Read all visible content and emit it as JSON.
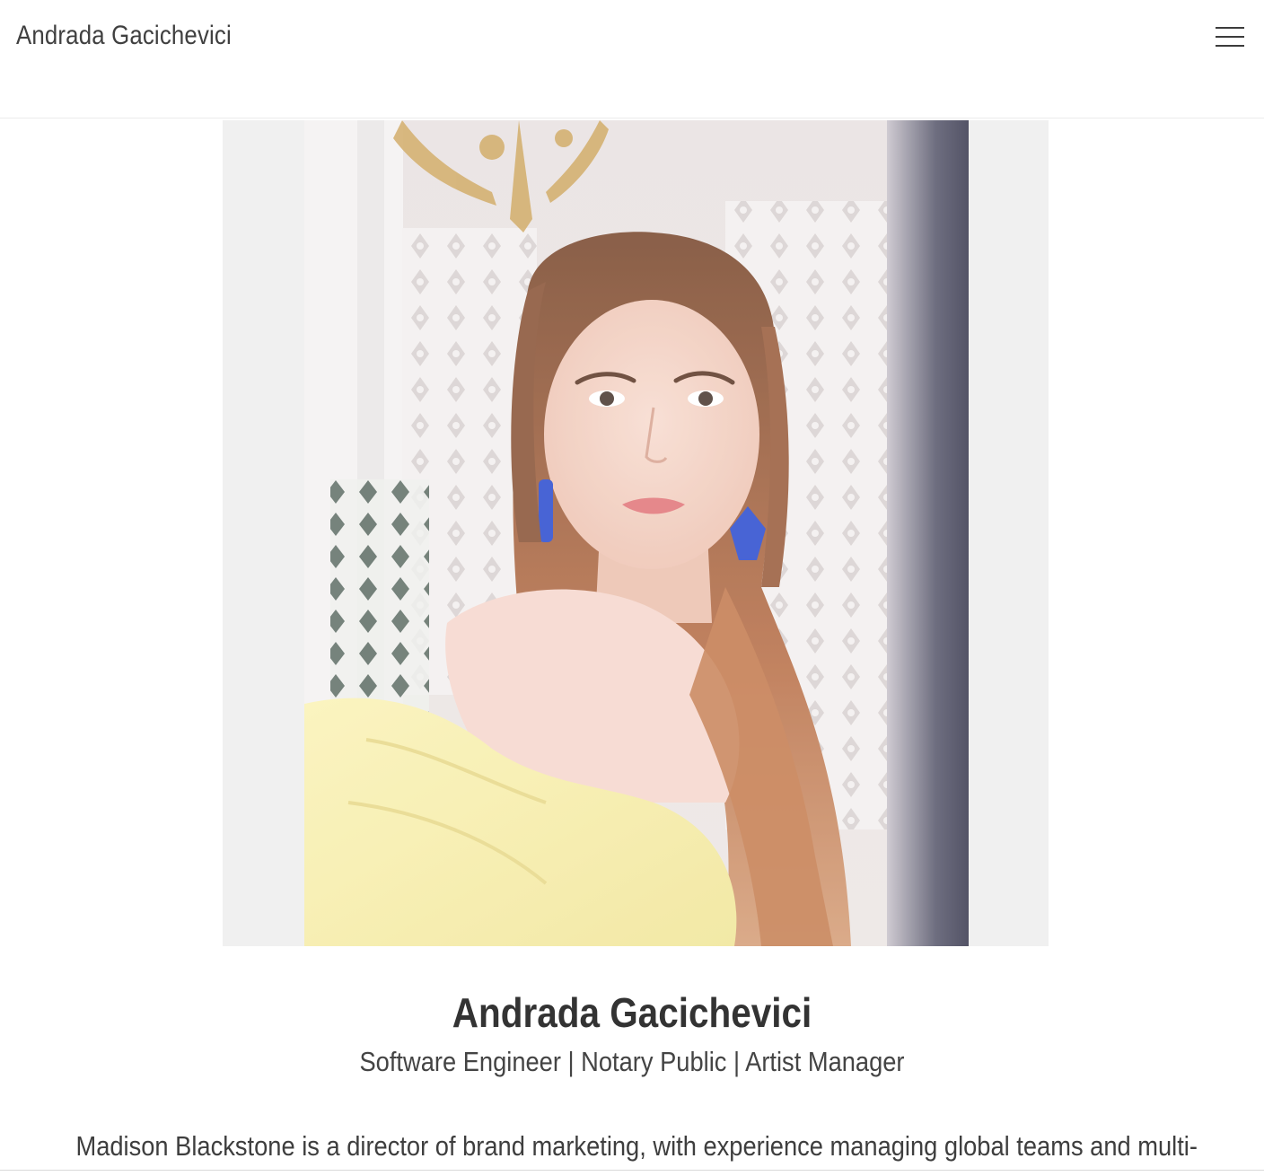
{
  "header": {
    "site_title": "Andrada Gacichevici",
    "menu_icon": "hamburger-menu-icon"
  },
  "profile": {
    "photo_alt": "Andrada Gacichevici",
    "name": "Andrada Gacichevici",
    "subtitle": "Software Engineer | Notary Public | Artist Manager",
    "bio": "Madison Blackstone is a director of brand marketing, with experience managing global teams and multi-"
  },
  "colors": {
    "background": "#ffffff",
    "text": "#333333",
    "photo_frame": "#f0f0f0"
  }
}
